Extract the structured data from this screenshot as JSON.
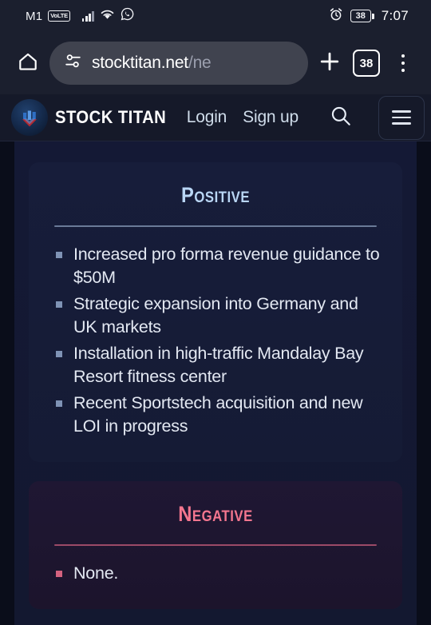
{
  "statusbar": {
    "carrier": "M1",
    "network_badge": "VoLTE",
    "signal_icon": "signal-bars-icon",
    "wifi_icon": "wifi-icon",
    "whatsapp_icon": "whatsapp-icon",
    "alarm_icon": "alarm-clock-icon",
    "battery_level": "38",
    "time": "7:07"
  },
  "browser": {
    "home_icon": "home-icon",
    "site_settings_icon": "page-info-icon",
    "url_host": "stocktitan.net",
    "url_path": "/ne",
    "url_full": "stocktitan.net/ne",
    "new_tab_icon": "plus-icon",
    "tab_count": "38",
    "menu_icon": "kebab-menu-icon"
  },
  "site_header": {
    "logo_icon": "stock-titan-logo-icon",
    "brand": "STOCK TITAN",
    "login_label": "Login",
    "signup_label": "Sign up",
    "search_icon": "search-icon",
    "menu_icon": "hamburger-menu-icon"
  },
  "cards": {
    "positive": {
      "title": "Positive",
      "accent_color": "#b9d6f5",
      "bullets": [
        "Increased pro forma revenue guidance to $50M",
        "Strategic expansion into Germany and UK markets",
        "Installation in high-traffic Mandalay Bay Resort fitness center",
        "Recent Sportstech acquisition and new LOI in progress"
      ]
    },
    "negative": {
      "title": "Negative",
      "accent_color": "#f4768f",
      "bullets": [
        "None."
      ]
    }
  }
}
